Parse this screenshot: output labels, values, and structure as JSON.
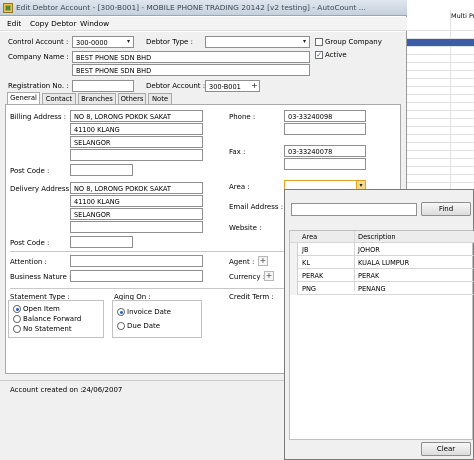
{
  "background": {
    "header_fragment": "Multi Pr"
  },
  "window": {
    "title": "Edit Debtor Account - [300-B001] - MOBILE PHONE TRADING 20142 [v2 testing] - AutoCount ..."
  },
  "menu": [
    "Edit",
    "Copy Debtor",
    "Window"
  ],
  "header": {
    "control_account_label": "Control Account :",
    "control_account_value": "300-0000",
    "debtor_type_label": "Debtor Type :",
    "debtor_type_value": "",
    "group_company_label": "Group Company",
    "group_company_checked": false,
    "active_label": "Active",
    "active_checked": true,
    "company_name_label": "Company Name :",
    "company_name_1": "BEST PHONE SDN BHD",
    "company_name_2": "BEST PHONE SDN BHD",
    "registration_label": "Registration No. :",
    "registration_value": "",
    "debtor_account_label": "Debtor Account :",
    "debtor_account_value": "300-B001"
  },
  "tabs": [
    "General",
    "Contact",
    "Branches",
    "Others",
    "Note"
  ],
  "active_tab": "General",
  "general": {
    "billing_address_label": "Billing Address :",
    "billing_address": [
      "NO 8, LORONG POKOK SAKAT",
      "41100 KLANG",
      "SELANGOR",
      ""
    ],
    "post_code_label": "Post Code :",
    "billing_post_code": "",
    "delivery_address_label": "Delivery Address :",
    "delivery_address": [
      "NO 8, LORONG POKOK SAKAT",
      "41100 KLANG",
      "SELANGOR",
      ""
    ],
    "delivery_post_code": "",
    "phone_label": "Phone :",
    "phone_value": "03-33240098",
    "fax_label": "Fax :",
    "fax_value": "03-33240078",
    "area_label": "Area :",
    "email_label": "Email Address :",
    "website_label": "Website :",
    "attention_label": "Attention :",
    "agent_label": "Agent :",
    "business_nature_label": "Business Nature :",
    "currency_label": "Currency :",
    "statement_type_label": "Statement Type :",
    "statement_options": [
      "Open Item",
      "Balance Forward",
      "No Statement"
    ],
    "statement_selected": 0,
    "credit_term_label": "Credit Term :",
    "aging_on_label": "Aging On :",
    "aging_options": [
      "Invoice Date",
      "Due Date"
    ],
    "aging_selected": 0
  },
  "footer": {
    "created_label": "Account created on :",
    "created_date": "24/06/2007"
  },
  "area_lookup": {
    "search_value": "",
    "find_label": "Find",
    "columns": [
      "Area",
      "Description"
    ],
    "rows": [
      {
        "area": "JB",
        "description": "JOHOR"
      },
      {
        "area": "KL",
        "description": "KUALA LUMPUR"
      },
      {
        "area": "PERAK",
        "description": "PERAK"
      },
      {
        "area": "PNG",
        "description": "PENANG"
      }
    ],
    "clear_label": "Clear"
  },
  "colors": {
    "selection_highlight": "#3c5ba8",
    "focus_border": "#e0a02a"
  },
  "icons": {
    "app": "autocount-app-icon",
    "combo": "chevron-down-icon",
    "lookup": "plus-icon"
  }
}
